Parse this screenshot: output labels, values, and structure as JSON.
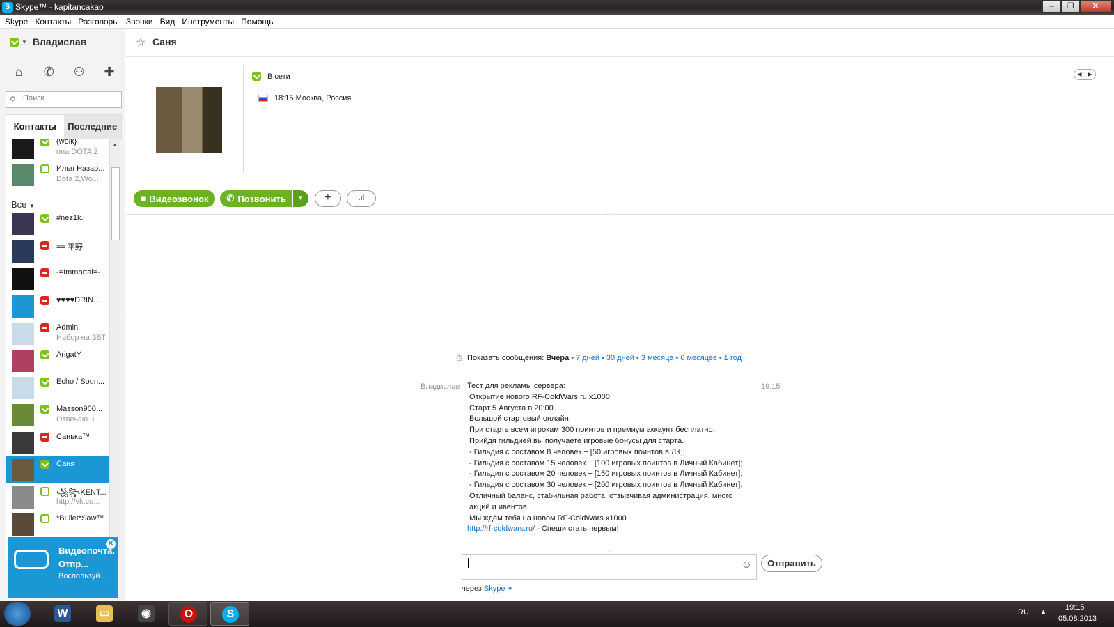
{
  "window": {
    "title": "Skype™ - kapitancakao",
    "app_icon": "S"
  },
  "menu": [
    "Skype",
    "Контакты",
    "Разговоры",
    "Звонки",
    "Вид",
    "Инструменты",
    "Помощь"
  ],
  "user": {
    "name": "Владислав",
    "status": "online"
  },
  "search": {
    "placeholder": "Поиск"
  },
  "tabs": {
    "contacts": "Контакты",
    "recent": "Последние"
  },
  "favorites": [
    {
      "name": "{wolk}",
      "mood": "опа DOTA 2",
      "status": "online",
      "avatar_color": "#1a1a1a"
    },
    {
      "name": "Илья Назар...",
      "mood": "Dota 2,Wo...",
      "status": "offline",
      "avatar_color": "#5a8a6a"
    }
  ],
  "all_label": "Все",
  "contacts": [
    {
      "name": "#nez1k.",
      "mood": "",
      "status": "online",
      "avatar_color": "#3a3550"
    },
    {
      "name": "== 平野",
      "mood": "",
      "status": "busy",
      "avatar_color": "#2a3a5a"
    },
    {
      "name": "-=Immortal=-",
      "mood": "",
      "status": "busy",
      "avatar_color": "#111111"
    },
    {
      "name": "♥♥♥♥DRIN...",
      "mood": "",
      "status": "busy",
      "avatar_color": "#1b97d6"
    },
    {
      "name": "Admin",
      "mood": "Набор на ЗБТ",
      "status": "busy",
      "avatar_color": "#c8dcea"
    },
    {
      "name": "ArigatY",
      "mood": "",
      "status": "online",
      "avatar_color": "#b04060"
    },
    {
      "name": "Echo / Soun...",
      "mood": "",
      "status": "online",
      "avatar_color": "#c8dcea"
    },
    {
      "name": "Masson900...",
      "mood": "Отвечаю н...",
      "status": "online",
      "avatar_color": "#6a8a3a"
    },
    {
      "name": "Санька™",
      "mood": "",
      "status": "busy",
      "avatar_color": "#3a3a3a"
    },
    {
      "name": "Саня",
      "mood": "",
      "status": "online",
      "avatar_color": "#6a5a40",
      "selected": true
    },
    {
      "name": "꧁꧂KENT...",
      "mood": "http://vk.co...",
      "status": "offline",
      "avatar_color": "#8a8a8a"
    },
    {
      "name": "*Bullet*Saw™",
      "mood": "",
      "status": "offline",
      "avatar_color": "#5a4a3a"
    }
  ],
  "promo": {
    "title": "Видеопочта. Отпр...",
    "sub": "Воспользуй..."
  },
  "chat": {
    "contact_name": "Саня",
    "status_text": "В сети",
    "location": "18:15 Москва, Россия",
    "btn_video": "Видеозвонок",
    "btn_call": "Позвонить",
    "history_label": "Показать сообщения:",
    "history_current": "Вчера",
    "history_links": [
      "7 дней",
      "30 дней",
      "3 месяца",
      "6 месяцев",
      "1 год"
    ],
    "message_sender": "Владислав",
    "message_time": "19:15",
    "message_text": "Тест для рекламы сервера:\n Открытие нового RF-ColdWars.ru x1000\n Старт 5 Августа в 20:00\n Большой стартовый онлайн.\n При старте всем игрокам 300 поинтов и премиум аккаунт бесплатно.\n Прийдя гильдией вы получаете игровые бонусы для старта.\n - Гильдия с составом 8 человек + [50 игровых поинтов в ЛК];\n - Гильдия с составом 15 человек + [100 игровых поинтов в Личный Кабинет];\n - Гильдия с составом 20 человек + [150 игровых поинтов в Личный Кабинет];\n - Гильдия с составом 30 человек + [200 игровых поинтов в Личный Кабинет];\n Отличный баланс, стабильная работа, отзывчивая администрация, много\n акций и ивентов.\n Мы ждём тебя на новом RF-ColdWars x1000",
    "message_link": "http://rf-coldwars.ru/",
    "message_tail": " - Спеши стать первым!",
    "send_label": "Отправить",
    "via_label": "через",
    "via_link": "Skype"
  },
  "taskbar": {
    "lang": "RU",
    "time": "19:15",
    "date": "05.08.2013"
  }
}
